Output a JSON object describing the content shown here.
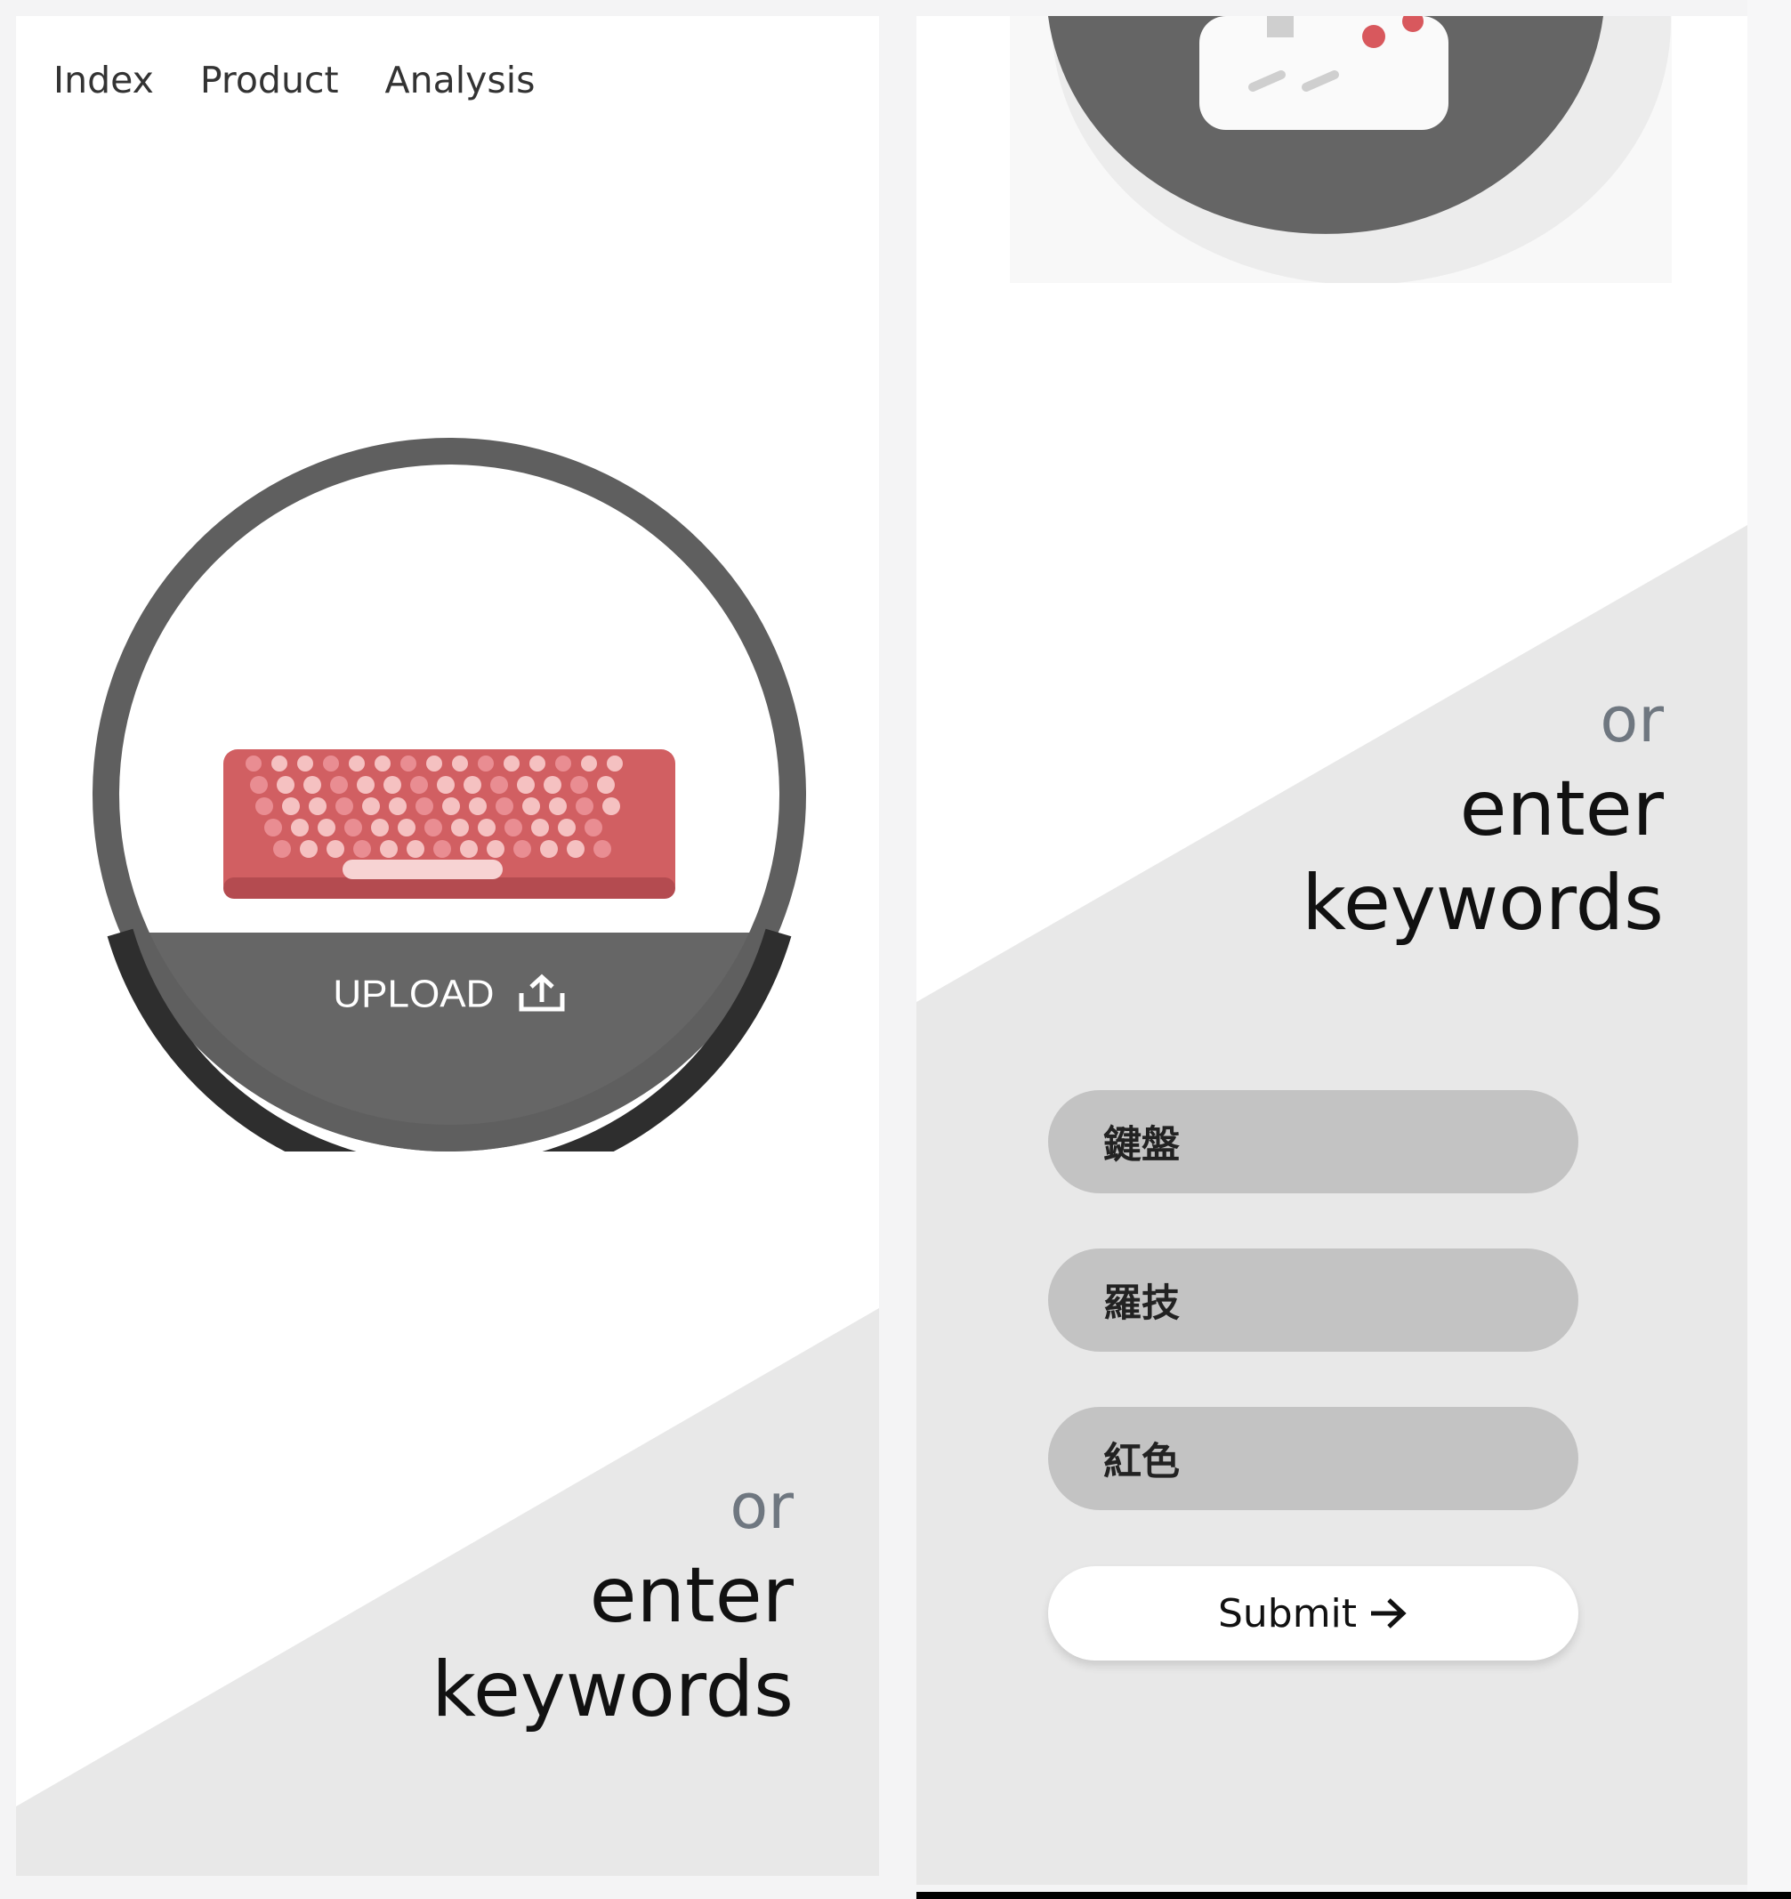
{
  "nav": {
    "items": [
      {
        "label": "Index"
      },
      {
        "label": "Product"
      },
      {
        "label": "Analysis"
      }
    ]
  },
  "upload": {
    "label": "UPLOAD",
    "icon": "upload-icon"
  },
  "prompt": {
    "or": "or",
    "line1": "enter",
    "line2": "keywords"
  },
  "keywords": [
    {
      "value": "鍵盤"
    },
    {
      "value": "羅技"
    },
    {
      "value": "紅色"
    }
  ],
  "submit": {
    "label": "Submit",
    "icon": "arrow-right-icon"
  },
  "colors": {
    "accent_dark": "#666666",
    "keyword_bg": "#c3c3c3",
    "diagonal_bg": "#e8e8e8",
    "keyboard_red": "#d9646a",
    "keyboard_pink": "#f2b5b5"
  }
}
